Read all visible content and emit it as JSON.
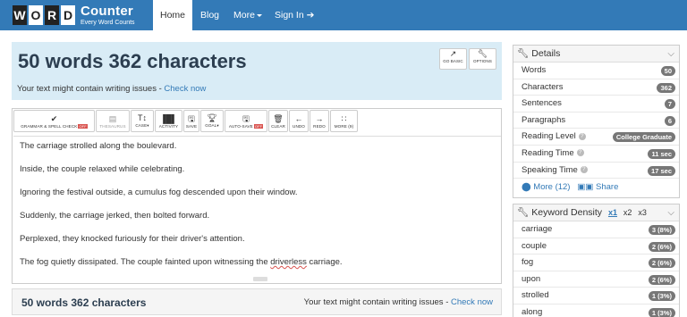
{
  "nav": {
    "logo_letters": [
      "W",
      "O",
      "R",
      "D"
    ],
    "logo_brand": "Counter",
    "logo_tagline": "Every Word Counts",
    "items": {
      "home": "Home",
      "blog": "Blog",
      "more": "More",
      "signin": "Sign In"
    }
  },
  "header": {
    "title": "50 words 362 characters",
    "issues_text": "Your text might contain writing issues - ",
    "check_now": "Check now",
    "go_basic": "GO BASIC",
    "options": "OPTIONS"
  },
  "toolbar": {
    "grammar": "GRAMMAR & SPELL CHECK",
    "grammar_state": "OFF",
    "thesaurus": "THESAURUS",
    "case": "CASE",
    "activity": "ACTIVITY",
    "save": "SAVE",
    "goal": "GOAL",
    "autosave": "AUTO-SAVE",
    "autosave_state": "OFF",
    "clear": "CLEAR",
    "undo": "UNDO",
    "redo": "REDO",
    "more": "MORE (9)"
  },
  "editor": {
    "paragraphs": [
      "The carriage strolled along the boulevard.",
      "Inside, the couple relaxed while celebrating.",
      "Ignoring the festival outside, a cumulus fog descended upon their window.",
      "Suddenly, the carriage jerked, then bolted forward.",
      "Perplexed, they knocked furiously for their driver's attention."
    ],
    "last_before": "The fog quietly dissipated. The couple fainted upon witnessing the ",
    "last_misspelled": "driverless",
    "last_after": " carriage."
  },
  "bottom": {
    "title": "50 words 362 characters",
    "issues_text": "Your text might contain writing issues - ",
    "check_now": "Check now"
  },
  "details": {
    "title": "Details",
    "rows": [
      {
        "label": "Words",
        "value": "50"
      },
      {
        "label": "Characters",
        "value": "362"
      },
      {
        "label": "Sentences",
        "value": "7"
      },
      {
        "label": "Paragraphs",
        "value": "6"
      },
      {
        "label": "Reading Level",
        "value": "College Graduate"
      },
      {
        "label": "Reading Time",
        "value": "11 sec"
      },
      {
        "label": "Speaking Time",
        "value": "17 sec"
      }
    ],
    "more": "More (12)",
    "share": "Share"
  },
  "keyword_density": {
    "title": "Keyword Density",
    "tabs": [
      "x1",
      "x2",
      "x3"
    ],
    "rows": [
      {
        "word": "carriage",
        "value": "3 (8%)"
      },
      {
        "word": "couple",
        "value": "2 (6%)"
      },
      {
        "word": "fog",
        "value": "2 (6%)"
      },
      {
        "word": "upon",
        "value": "2 (6%)"
      },
      {
        "word": "strolled",
        "value": "1 (3%)"
      },
      {
        "word": "along",
        "value": "1 (3%)"
      }
    ]
  },
  "colors": {
    "nav": "#337ab7",
    "header_panel": "#d9ecf6",
    "badge": "#777777",
    "off_badge": "#d9534f"
  }
}
